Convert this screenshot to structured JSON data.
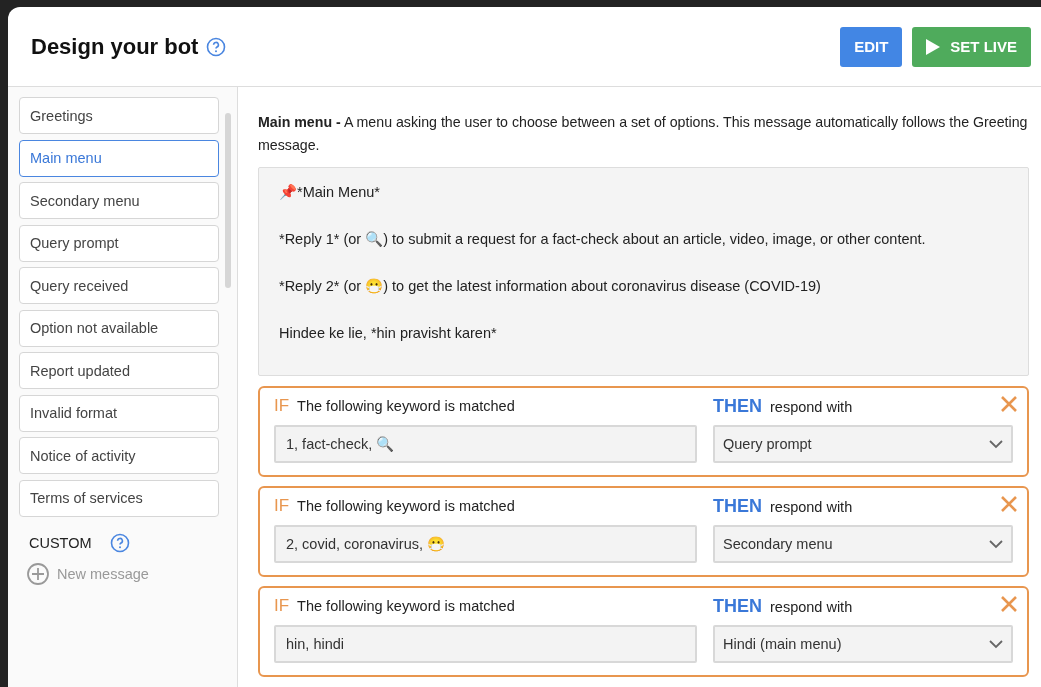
{
  "header": {
    "title": "Design your bot",
    "buttons": [
      {
        "label": "EDIT",
        "kind": "edit"
      },
      {
        "label": "SET LIVE",
        "kind": "live"
      }
    ]
  },
  "sidebar": {
    "items": [
      {
        "label": "Greetings",
        "selected": false
      },
      {
        "label": "Main menu",
        "selected": true
      },
      {
        "label": "Secondary menu",
        "selected": false
      },
      {
        "label": "Query prompt",
        "selected": false
      },
      {
        "label": "Query received",
        "selected": false
      },
      {
        "label": "Option not available",
        "selected": false
      },
      {
        "label": "Report updated",
        "selected": false
      },
      {
        "label": "Invalid format",
        "selected": false
      },
      {
        "label": "Notice of activity",
        "selected": false
      },
      {
        "label": "Terms of services",
        "selected": false
      }
    ],
    "custom_heading": "CUSTOM",
    "new_message": "New message"
  },
  "description": "**Main menu -** A menu asking the user to choose between a set of options. This message automatically follows the Greeting message.",
  "message_lines": [
    "📌*Main Menu*",
    "*Reply 1* (or 🔍) to submit a request for a fact-check about an article, video, image, or other content.",
    "*Reply 2* (or 😷) to get the latest information about coronavirus disease (COVID-19)",
    "Hindee ke lie, *hin pravisht karen*"
  ],
  "rules": [
    {
      "if": "IF",
      "condition": "The following keyword is matched",
      "then": "THEN",
      "action": "respond with",
      "keywords": "1, fact-check, 🔍",
      "response": "Query prompt"
    },
    {
      "if": "IF",
      "condition": "The following keyword is matched",
      "then": "THEN",
      "action": "respond with",
      "keywords": "2, covid, coronavirus, 😷",
      "response": "Secondary menu"
    },
    {
      "if": "IF",
      "condition": "The following keyword is matched",
      "then": "THEN",
      "action": "respond with",
      "keywords": "hin, hindi",
      "response": "Hindi (main menu)"
    }
  ]
}
